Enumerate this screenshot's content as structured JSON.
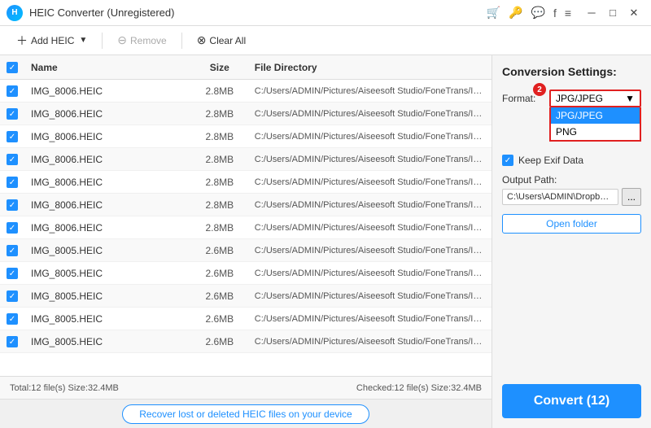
{
  "titleBar": {
    "title": "HEIC Converter (Unregistered)",
    "logoText": "H"
  },
  "toolbar": {
    "addHeic": "Add HEIC",
    "remove": "Remove",
    "clearAll": "Clear All"
  },
  "table": {
    "columns": [
      "Name",
      "Size",
      "File Directory"
    ],
    "rows": [
      {
        "name": "IMG_8006.HEIC",
        "size": "2.8MB",
        "dir": "C:/Users/ADMIN/Pictures/Aiseesoft Studio/FoneTrans/IMG_80..."
      },
      {
        "name": "IMG_8006.HEIC",
        "size": "2.8MB",
        "dir": "C:/Users/ADMIN/Pictures/Aiseesoft Studio/FoneTrans/IMG_80..."
      },
      {
        "name": "IMG_8006.HEIC",
        "size": "2.8MB",
        "dir": "C:/Users/ADMIN/Pictures/Aiseesoft Studio/FoneTrans/IMG_80..."
      },
      {
        "name": "IMG_8006.HEIC",
        "size": "2.8MB",
        "dir": "C:/Users/ADMIN/Pictures/Aiseesoft Studio/FoneTrans/IMG_80..."
      },
      {
        "name": "IMG_8006.HEIC",
        "size": "2.8MB",
        "dir": "C:/Users/ADMIN/Pictures/Aiseesoft Studio/FoneTrans/IMG_80..."
      },
      {
        "name": "IMG_8006.HEIC",
        "size": "2.8MB",
        "dir": "C:/Users/ADMIN/Pictures/Aiseesoft Studio/FoneTrans/IMG_80..."
      },
      {
        "name": "IMG_8006.HEIC",
        "size": "2.8MB",
        "dir": "C:/Users/ADMIN/Pictures/Aiseesoft Studio/FoneTrans/IMG_80..."
      },
      {
        "name": "IMG_8005.HEIC",
        "size": "2.6MB",
        "dir": "C:/Users/ADMIN/Pictures/Aiseesoft Studio/FoneTrans/IMG_80..."
      },
      {
        "name": "IMG_8005.HEIC",
        "size": "2.6MB",
        "dir": "C:/Users/ADMIN/Pictures/Aiseesoft Studio/FoneTrans/IMG_80..."
      },
      {
        "name": "IMG_8005.HEIC",
        "size": "2.6MB",
        "dir": "C:/Users/ADMIN/Pictures/Aiseesoft Studio/FoneTrans/IMG_80..."
      },
      {
        "name": "IMG_8005.HEIC",
        "size": "2.6MB",
        "dir": "C:/Users/ADMIN/Pictures/Aiseesoft Studio/FoneTrans/IMG_80..."
      },
      {
        "name": "IMG_8005.HEIC",
        "size": "2.6MB",
        "dir": "C:/Users/ADMIN/Pictures/Aiseesoft Studio/FoneTrans/IMG_80..."
      }
    ]
  },
  "statusBar": {
    "total": "Total:12 file(s) Size:32.4MB",
    "checked": "Checked:12 file(s) Size:32.4MB"
  },
  "bottomBar": {
    "recoverBtn": "Recover lost or deleted HEIC files on your device"
  },
  "rightPanel": {
    "title": "Conversion Settings:",
    "formatLabel": "Format:",
    "selectedFormat": "JPG/JPEG",
    "options": [
      "JPG/JPEG",
      "PNG"
    ],
    "badgeNumber": "2",
    "keepExif": "Keep Exif Data",
    "outputPathLabel": "Output Path:",
    "outputPath": "C:\\Users\\ADMIN\\Dropbox\\PC\\...",
    "browseBtnLabel": "...",
    "openFolderLabel": "Open folder",
    "convertLabel": "Convert (12)"
  }
}
